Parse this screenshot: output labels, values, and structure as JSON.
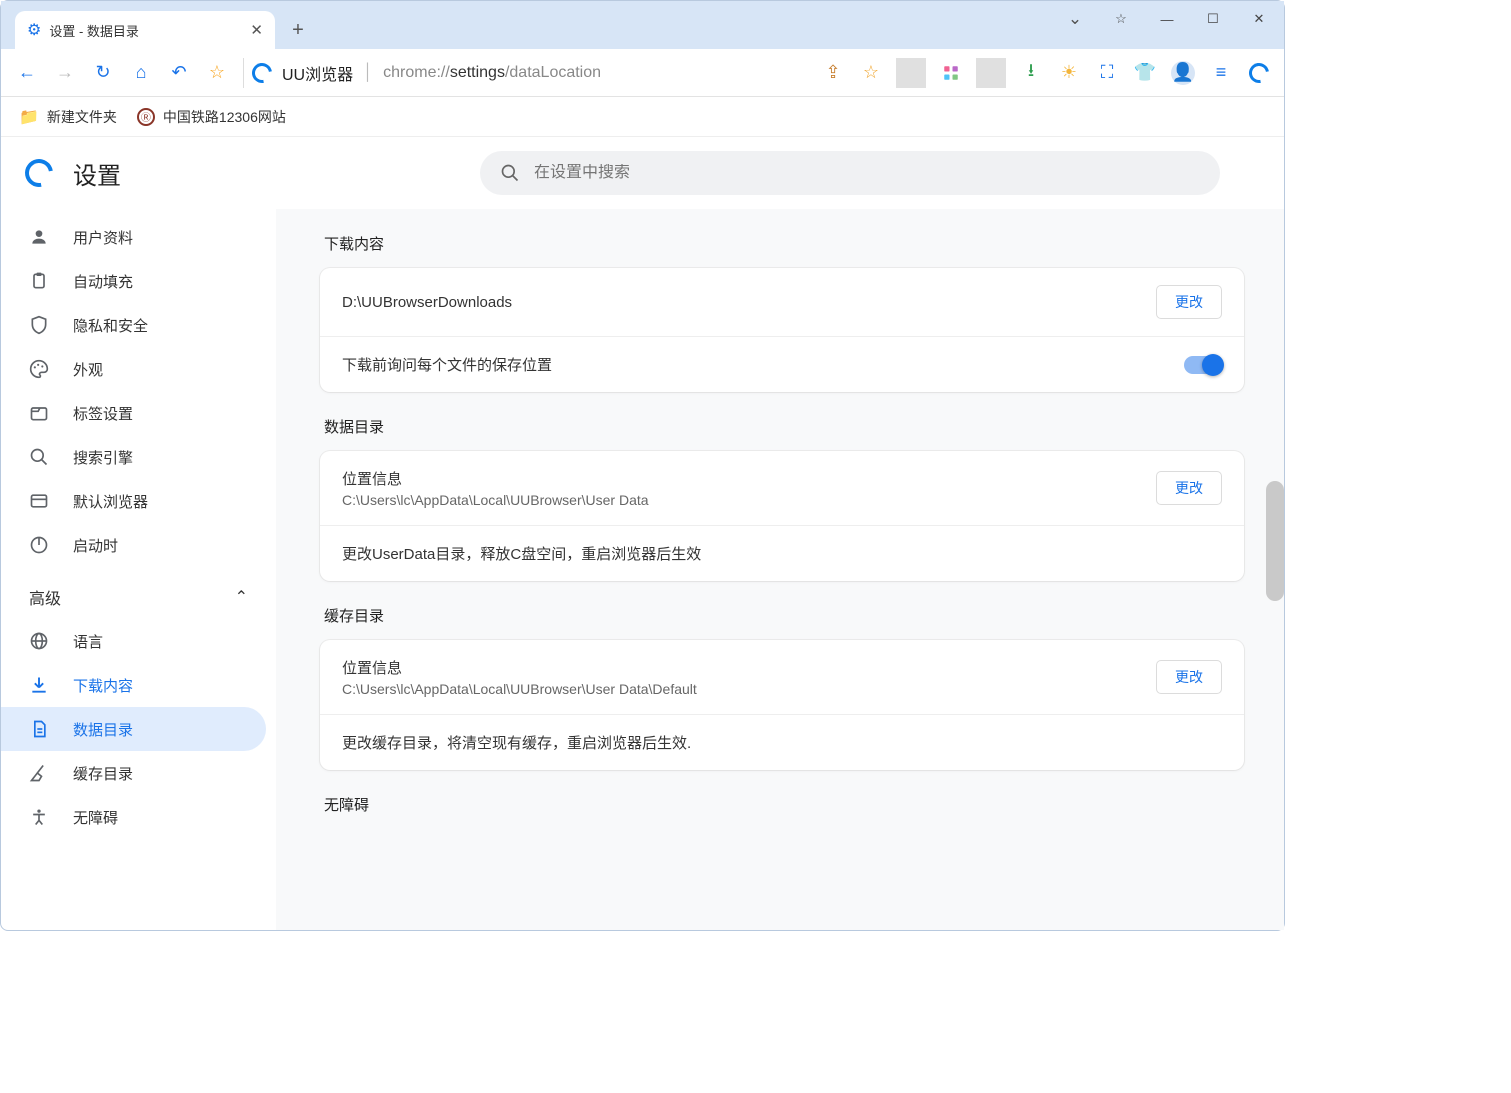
{
  "window": {
    "tab_title": "设置 - 数据目录"
  },
  "addressbar": {
    "brand": "UU浏览器",
    "url_prefix": "chrome://",
    "url_bold": "settings",
    "url_suffix": "/dataLocation"
  },
  "bookmarks": [
    {
      "label": "新建文件夹",
      "kind": "folder"
    },
    {
      "label": "中国铁路12306网站",
      "kind": "rail"
    }
  ],
  "app": {
    "title": "设置",
    "search_placeholder": "在设置中搜索"
  },
  "sidebar": {
    "items": [
      {
        "label": "用户资料",
        "icon": "user"
      },
      {
        "label": "自动填充",
        "icon": "clipboard"
      },
      {
        "label": "隐私和安全",
        "icon": "shield"
      },
      {
        "label": "外观",
        "icon": "palette"
      },
      {
        "label": "标签设置",
        "icon": "tab"
      },
      {
        "label": "搜索引擎",
        "icon": "search"
      },
      {
        "label": "默认浏览器",
        "icon": "window"
      },
      {
        "label": "启动时",
        "icon": "power"
      }
    ],
    "advanced_label": "高级",
    "adv_items": [
      {
        "label": "语言",
        "icon": "globe"
      },
      {
        "label": "下载内容",
        "icon": "download",
        "accent": true
      },
      {
        "label": "数据目录",
        "icon": "file",
        "active": true
      },
      {
        "label": "缓存目录",
        "icon": "broom"
      },
      {
        "label": "无障碍",
        "icon": "acc"
      }
    ]
  },
  "sections": {
    "download": {
      "title": "下载内容",
      "path": "D:\\UUBrowserDownloads",
      "change": "更改",
      "ask_label": "下载前询问每个文件的保存位置"
    },
    "datadir": {
      "title": "数据目录",
      "loc_label": "位置信息",
      "loc_path": "C:\\Users\\lc\\AppData\\Local\\UUBrowser\\User Data",
      "change": "更改",
      "note": "更改UserData目录，释放C盘空间，重启浏览器后生效"
    },
    "cachedir": {
      "title": "缓存目录",
      "loc_label": "位置信息",
      "loc_path": "C:\\Users\\lc\\AppData\\Local\\UUBrowser\\User Data\\Default",
      "change": "更改",
      "note": "更改缓存目录，将清空现有缓存，重启浏览器后生效."
    },
    "accessibility": {
      "title": "无障碍"
    }
  }
}
